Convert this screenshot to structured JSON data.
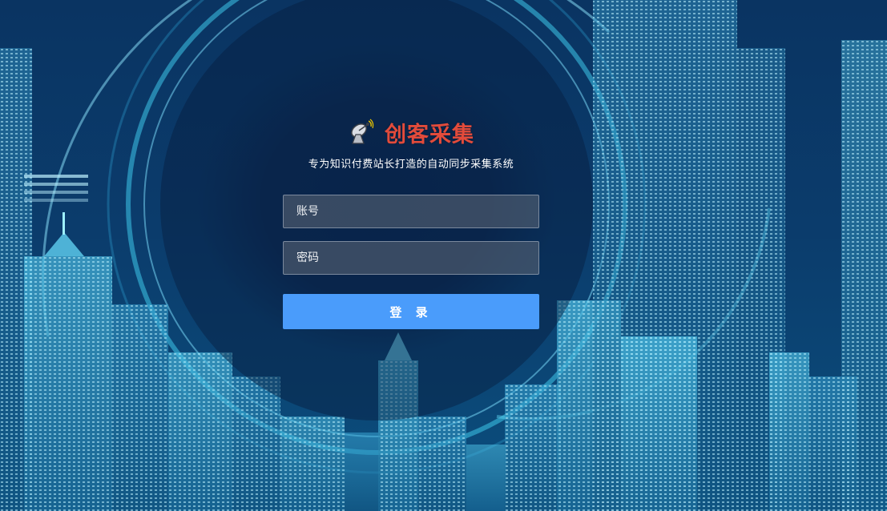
{
  "brand": {
    "title": "创客采集",
    "logo_icon": "satellite-dish-icon",
    "title_color": "#e24b3b"
  },
  "subtitle": "专为知识付费站长打造的自动同步采集系统",
  "form": {
    "account_placeholder": "账号",
    "password_placeholder": "密码",
    "account_value": "",
    "password_value": "",
    "submit_label": "登 录",
    "submit_color": "#4a9cfb"
  },
  "background": {
    "theme": "futuristic-city-skyline",
    "accent_color": "#37c3e6",
    "base_color": "#0a2f5c"
  }
}
